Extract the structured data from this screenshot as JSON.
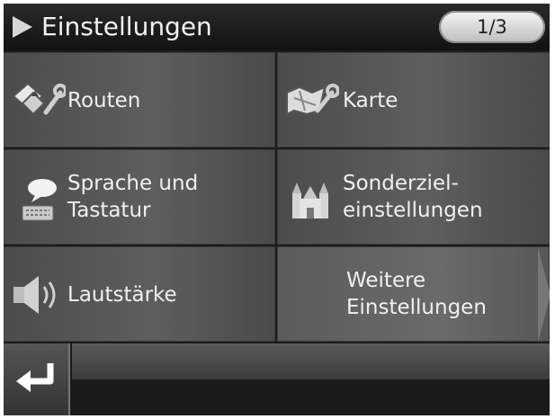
{
  "header": {
    "title": "Einstellungen",
    "page_indicator": "1/3"
  },
  "menu": {
    "routes": {
      "line1": "Routen",
      "icon": "route-signs-icon"
    },
    "map": {
      "line1": "Karte",
      "icon": "map-wrench-icon"
    },
    "language": {
      "line1": "Sprache und",
      "line2": "Tastatur",
      "icon": "speech-keyboard-icon"
    },
    "poi": {
      "line1": "Sonderziel-",
      "line2": "einstellungen",
      "icon": "castle-icon"
    },
    "volume": {
      "line1": "Lautstärke",
      "icon": "speaker-icon"
    },
    "more": {
      "line1": "Weitere",
      "line2": "Einstellungen"
    }
  },
  "footer": {
    "back_icon": "return-arrow-icon"
  },
  "colors": {
    "tile_background": "#555555",
    "text": "#f0f0f0",
    "header_background": "#1b1b1b",
    "pill": "#e0e0e0"
  }
}
